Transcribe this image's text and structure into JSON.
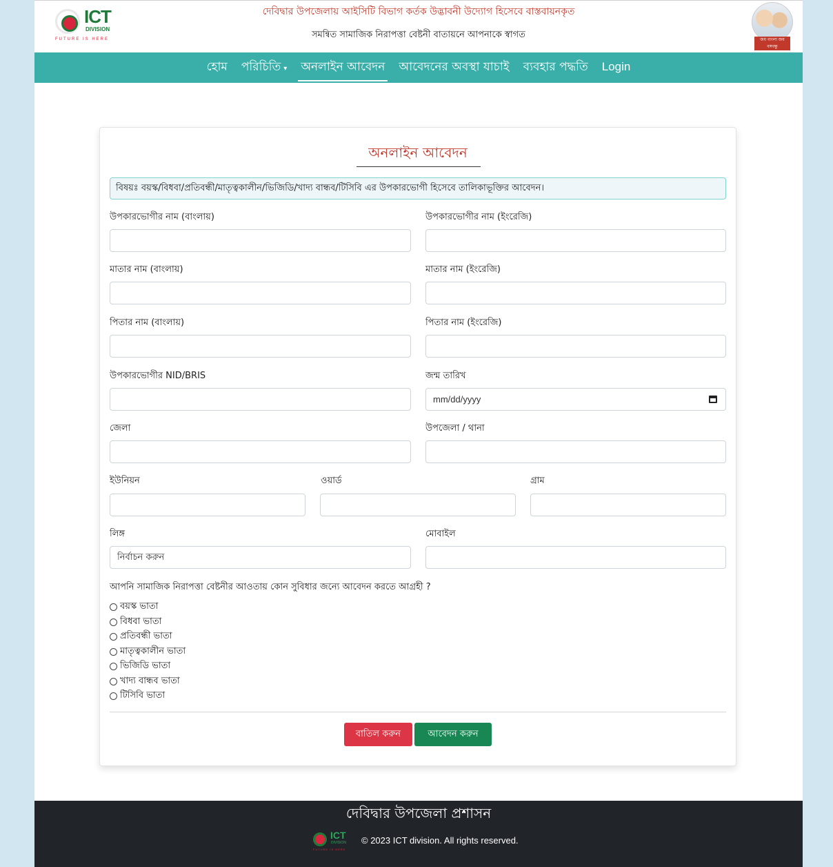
{
  "header": {
    "logo_text": "ICT",
    "logo_sub": "DIVISION",
    "logo_tagline": "FUTURE IS HERE",
    "line1": "দেবিদ্বার উপজেলায় আইসিটি বিভাগ কর্তক উদ্ভাবনী উদ্যোগ হিসেবে বাস্তবায়নকৃত",
    "line2": "সমন্বিত সামাজিক নিরাপত্তা বেষ্টনী বাতায়নে আপনাকে স্বাগত",
    "portrait_caption": "জয় বাংলা জয় বঙ্গবন্ধু"
  },
  "nav": {
    "items": [
      {
        "label": "হোম"
      },
      {
        "label": "পরিচিতি",
        "caret": "▾"
      },
      {
        "label": "অনলাইন আবেদন",
        "active": true
      },
      {
        "label": "আবেদনের অবস্থা যাচাই"
      },
      {
        "label": "ব্যবহার পদ্ধতি"
      },
      {
        "label": "Login"
      }
    ]
  },
  "form": {
    "title": "অনলাইন আবেদন",
    "subject": "বিষয়ঃ বয়স্ক/বিধবা/প্রতিবন্ধী/মাতৃত্বকালীন/ভিজিডি/খাদ্য বান্ধব/টিসিবি এর উপকারভোগী হিসেবে তালিকাভূক্তির আবেদন।",
    "fields": {
      "name_bn": "উপকারভোগীর নাম (বাংলায়)",
      "name_en": "উপকারভোগীর নাম (ইংরেজি)",
      "mother_bn": "মাতার নাম (বাংলায়)",
      "mother_en": "মাতার নাম (ইংরেজি)",
      "father_bn": "পিতার নাম (বাংলায়)",
      "father_en": "পিতার নাম (ইংরেজি)",
      "nid": "উপকারভোগীর NID/BRIS",
      "dob": "জন্ম তারিখ",
      "dob_placeholder": "mm/dd/yyyy",
      "district": "জেলা",
      "upazila": "উপজেলা / থানা",
      "union": "ইউনিয়ন",
      "ward": "ওয়ার্ড",
      "village": "গ্রাম",
      "gender": "লিঙ্গ",
      "gender_selected": "নির্বাচন করুন",
      "mobile": "মোবাইল"
    },
    "question": "আপনি সামাজিক নিরাপত্তা বেষ্টনীর আওতায় কোন সুবিধার জন্যে আবেদন করতে আগ্রহী ?",
    "options": [
      "বয়স্ক ভাতা",
      "বিধবা ভাতা",
      "প্রতিবন্ধী ভাতা",
      "মাতৃত্বকালীন ভাতা",
      "ভিজিডি ভাতা",
      "খাদ্য বান্ধব ভাতা",
      "টিসিবি ভাতা"
    ],
    "cancel_label": "বাতিল করুন",
    "submit_label": "আবেদন করুন"
  },
  "footer": {
    "title": "দেবিদ্বার উপজেলা প্রশাসন",
    "logo_text": "ICT",
    "logo_sub": "DIVISION",
    "logo_tagline": "FUTURE IS HERE",
    "copyright": "© 2023 ICT division. All rights reserved."
  },
  "colors": {
    "nav_bg": "#3aafa9",
    "accent_red": "#c0392b",
    "cancel": "#dc3545",
    "submit": "#198754",
    "footer_bg": "#212529",
    "side_bg": "#d1e6f0"
  }
}
